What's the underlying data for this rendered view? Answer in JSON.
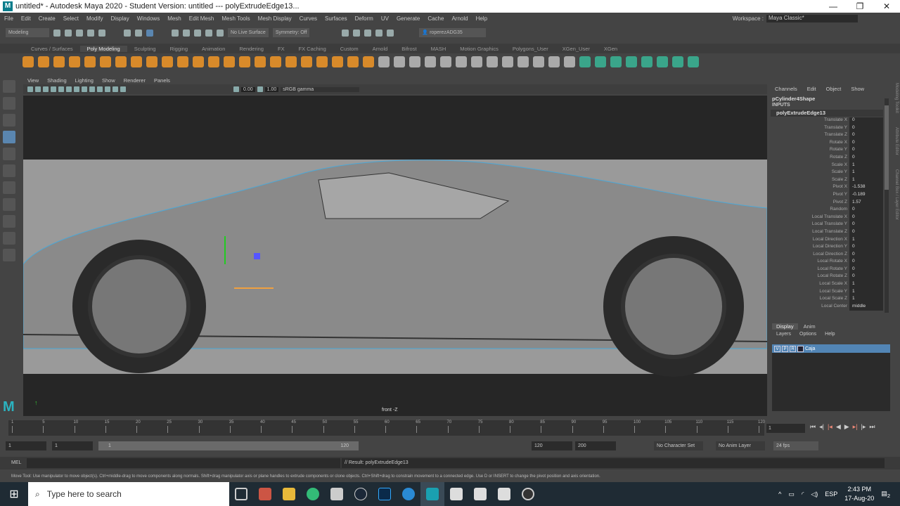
{
  "title": "untitled* - Autodesk Maya 2020 - Student Version: untitled  ---  polyExtrudeEdge13...",
  "menus": [
    "File",
    "Edit",
    "Create",
    "Select",
    "Modify",
    "Display",
    "Windows",
    "Mesh",
    "Edit Mesh",
    "Mesh Tools",
    "Mesh Display",
    "Curves",
    "Surfaces",
    "Deform",
    "UV",
    "Generate",
    "Cache",
    "Arnold",
    "Help"
  ],
  "workspace": {
    "label": "Workspace :",
    "value": "Maya Classic*"
  },
  "status": {
    "mode": "Modeling",
    "live": "No Live Surface",
    "symmetry": "Symmetry: Off",
    "user": "roperezADG35"
  },
  "shelf_tabs": [
    "Curves / Surfaces",
    "Poly Modeling",
    "Sculpting",
    "Rigging",
    "Animation",
    "Rendering",
    "FX",
    "FX Caching",
    "Custom",
    "Arnold",
    "Bifrost",
    "MASH",
    "Motion Graphics",
    "Polygons_User",
    "XGen_User",
    "XGen"
  ],
  "active_shelf": "Poly Modeling",
  "viewport": {
    "menus": [
      "View",
      "Shading",
      "Lighting",
      "Show",
      "Renderer",
      "Panels"
    ],
    "exposure": "0.00",
    "gamma": "1.00",
    "colorspace": "sRGB gamma",
    "view_label": "front -Z"
  },
  "channel_box": {
    "menus": [
      "Channels",
      "Edit",
      "Object",
      "Show"
    ],
    "object": "pCylinder4Shape",
    "inputs": "INPUTS",
    "node": "polyExtrudeEdge13",
    "attrs": [
      [
        "Translate X",
        "0"
      ],
      [
        "Translate Y",
        "0"
      ],
      [
        "Translate Z",
        "0"
      ],
      [
        "Rotate X",
        "0"
      ],
      [
        "Rotate Y",
        "0"
      ],
      [
        "Rotate Z",
        "0"
      ],
      [
        "Scale X",
        "1"
      ],
      [
        "Scale Y",
        "1"
      ],
      [
        "Scale Z",
        "1"
      ],
      [
        "Pivot X",
        "-1.538"
      ],
      [
        "Pivot Y",
        "-0.189"
      ],
      [
        "Pivot Z",
        "1.57"
      ],
      [
        "Random",
        "0"
      ],
      [
        "Local Translate X",
        "0"
      ],
      [
        "Local Translate Y",
        "0"
      ],
      [
        "Local Translate Z",
        "0"
      ],
      [
        "Local Direction X",
        "1"
      ],
      [
        "Local Direction Y",
        "0"
      ],
      [
        "Local Direction Z",
        "0"
      ],
      [
        "Local Rotate X",
        "0"
      ],
      [
        "Local Rotate Y",
        "0"
      ],
      [
        "Local Rotate Z",
        "0"
      ],
      [
        "Local Scale X",
        "1"
      ],
      [
        "Local Scale Y",
        "1"
      ],
      [
        "Local Scale Z",
        "1"
      ],
      [
        "Local Center",
        "middle"
      ]
    ],
    "side_tabs": [
      "Modeling Toolkit",
      "Attribute Editor",
      "Channel Box / Layer Editor"
    ]
  },
  "layer_editor": {
    "tabs": [
      "Display",
      "Anim"
    ],
    "menus": [
      "Layers",
      "Options",
      "Help"
    ],
    "layer": {
      "v": "V",
      "p": "P",
      "r": "R",
      "name": "Caja"
    }
  },
  "timeline": {
    "ticks": [
      "1",
      "5",
      "10",
      "15",
      "20",
      "25",
      "30",
      "35",
      "40",
      "45",
      "50",
      "55",
      "60",
      "65",
      "70",
      "75",
      "80",
      "85",
      "90",
      "95",
      "100",
      "105",
      "110",
      "115",
      "120"
    ],
    "current": "1"
  },
  "range": {
    "start": "1",
    "playstart": "1",
    "slider_start": "1",
    "slider_end": "120",
    "playend": "120",
    "end": "200",
    "char_set": "No Character Set",
    "anim_layer": "No Anim Layer",
    "fps": "24 fps"
  },
  "command": {
    "label": "MEL",
    "result": "// Result: polyExtrudeEdge13"
  },
  "help": "Move Tool: Use manipulator to move object(s). Ctrl+middle-drag to move components along normals. Shift+drag manipulator axis or plane handles to extrude components or clone objects. Ctrl+Shift+drag to constrain movement to a connected edge. Use D or INSERT to change the pivot position and axis orientation.",
  "taskbar": {
    "search": "Type here to search",
    "lang": "ESP",
    "time": "2:43 PM",
    "date": "17-Aug-20",
    "notif": "2"
  },
  "logo": "M"
}
